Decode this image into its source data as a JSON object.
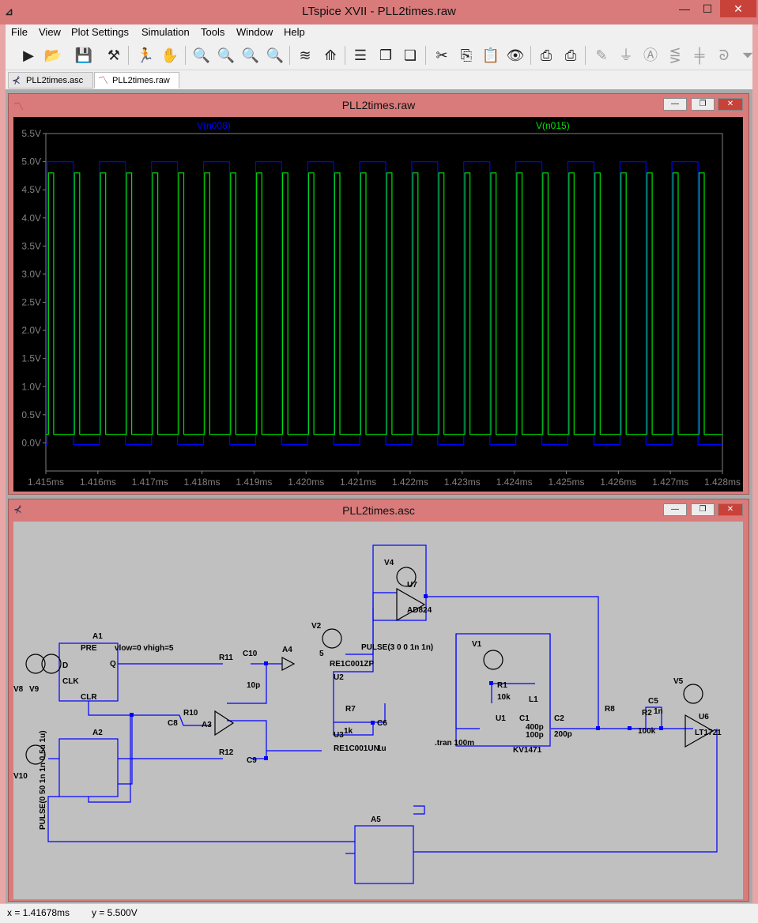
{
  "window": {
    "title": "LTspice XVII - PLL2times.raw",
    "minimize": "—",
    "maximize": "☐",
    "close": "✕"
  },
  "menu": [
    "File",
    "View",
    "Plot Settings",
    "Simulation",
    "Tools",
    "Window",
    "Help"
  ],
  "tabs": [
    {
      "label": "PLL2times.asc",
      "icon": "schematic-icon"
    },
    {
      "label": "PLL2times.raw",
      "icon": "waveform-icon"
    }
  ],
  "waveform_window": {
    "title": "PLL2times.raw",
    "traces": [
      {
        "name": "V(n008)",
        "color": "#0000ff"
      },
      {
        "name": "V(n015)",
        "color": "#00e000"
      }
    ]
  },
  "schematic_window": {
    "title": "PLL2times.asc",
    "labels": [
      "A1",
      "PRE",
      "D",
      "Q",
      "CLK",
      "CLR",
      "vlow=0 vhigh=5",
      "A2",
      "A3",
      "A4",
      "A5",
      "V8",
      "V9",
      "V10",
      "V1",
      "V2",
      "V4",
      "V5",
      "R1",
      "10k",
      "R2",
      "100k",
      "R7",
      "1k",
      "R8",
      "R10",
      "R11",
      "R12",
      "C1",
      "400p",
      "C2",
      "200p",
      "C5",
      "1n",
      "C6",
      "1u",
      "C8",
      "10p",
      "C9",
      "C10",
      "L1",
      "100p",
      "U1",
      "U2",
      "U3",
      "U6",
      "U7",
      "AD824",
      "LT1721",
      "KV1471",
      "RE1C001ZP",
      "RE1C001UN",
      "PULSE(3 0 0 1n 1n)",
      "PULSE(0 50 1n 1n 0.5u 1u)",
      ".tran 100m",
      "5"
    ]
  },
  "chart_data": {
    "type": "line",
    "title": "",
    "xlabel": "",
    "ylabel": "",
    "x_ticks": [
      "1.415ms",
      "1.416ms",
      "1.417ms",
      "1.418ms",
      "1.419ms",
      "1.420ms",
      "1.421ms",
      "1.422ms",
      "1.423ms",
      "1.424ms",
      "1.425ms",
      "1.426ms",
      "1.427ms",
      "1.428ms"
    ],
    "y_ticks": [
      "0.0V",
      "0.5V",
      "1.0V",
      "1.5V",
      "2.0V",
      "2.5V",
      "3.0V",
      "3.5V",
      "4.0V",
      "4.5V",
      "5.0V",
      "5.5V"
    ],
    "xlim": [
      1.415,
      1.428
    ],
    "ylim": [
      -0.5,
      5.5
    ],
    "grid": false,
    "series": [
      {
        "name": "V(n008)",
        "color": "#0000ff",
        "kind": "square",
        "high": 5.0,
        "low": -0.03,
        "period_ms": 0.001,
        "first_rise_ms": 1.41503,
        "duty": 0.5
      },
      {
        "name": "V(n015)",
        "color": "#00e000",
        "kind": "square",
        "high": 4.8,
        "low": 0.15,
        "period_ms": 0.0005,
        "first_rise_ms": 1.41505,
        "duty": 0.2
      }
    ]
  },
  "status": {
    "x": "x = 1.41678ms",
    "y": "y = 5.500V"
  }
}
